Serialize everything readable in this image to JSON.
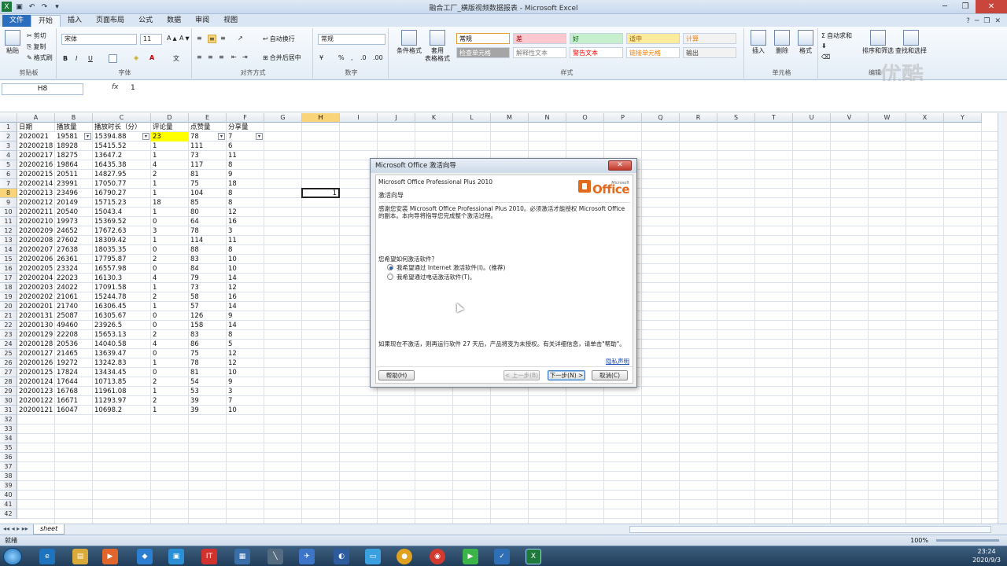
{
  "window": {
    "title": "融合工厂_横版视频数据报表 - Microsoft Excel"
  },
  "tabs": [
    "文件",
    "开始",
    "插入",
    "页面布局",
    "公式",
    "数据",
    "审阅",
    "视图"
  ],
  "ribbon": {
    "clipboard": {
      "label": "剪贴板",
      "paste": "粘贴",
      "cut": "剪切",
      "copy": "复制",
      "format_painter": "格式刷"
    },
    "font": {
      "label": "字体",
      "name": "宋体",
      "size": "11"
    },
    "alignment": {
      "label": "对齐方式",
      "wrap": "自动换行",
      "merge": "合并后居中"
    },
    "number": {
      "label": "数字",
      "format": "常规"
    },
    "styles": {
      "label": "样式",
      "cond": "条件格式",
      "table": "套用\n表格格式",
      "cells": [
        {
          "t": "常规",
          "bg": "#ffffff",
          "c": "#000000"
        },
        {
          "t": "差",
          "bg": "#ffc7ce",
          "c": "#9c0006"
        },
        {
          "t": "好",
          "bg": "#c6efce",
          "c": "#006100"
        },
        {
          "t": "适中",
          "bg": "#ffeb9c",
          "c": "#9c5700"
        },
        {
          "t": "计算",
          "bg": "#f2f2f2",
          "c": "#fa7d00"
        },
        {
          "t": "检查单元格",
          "bg": "#a5a5a5",
          "c": "#ffffff"
        },
        {
          "t": "解释性文本",
          "bg": "#ffffff",
          "c": "#7f7f7f"
        },
        {
          "t": "警告文本",
          "bg": "#ffffff",
          "c": "#ff0000"
        },
        {
          "t": "链接单元格",
          "bg": "#ffffff",
          "c": "#fa7d00"
        },
        {
          "t": "输出",
          "bg": "#f2f2f2",
          "c": "#3f3f3f"
        }
      ]
    },
    "cells": {
      "label": "单元格",
      "insert": "插入",
      "delete": "删除",
      "format": "格式"
    },
    "editing": {
      "label": "编辑",
      "autosum": "自动求和",
      "sort": "排序和筛选",
      "find": "查找和选择"
    }
  },
  "formula_bar": {
    "name": "H8",
    "fx": "fx",
    "value": "1"
  },
  "columns": [
    "A",
    "B",
    "C",
    "D",
    "E",
    "F",
    "G",
    "H",
    "I",
    "J",
    "K",
    "L",
    "M",
    "N",
    "O",
    "P",
    "Q",
    "R",
    "S",
    "T",
    "U",
    "V",
    "W",
    "X",
    "Y"
  ],
  "headers": [
    "日期",
    "播放量",
    "播放时长（分）",
    "评论量",
    "点赞量",
    "分享量"
  ],
  "rows": [
    [
      "2020021",
      "19581",
      "15394.88",
      "23",
      "78",
      "7"
    ],
    [
      "20200218",
      "18928",
      "15415.52",
      "1",
      "111",
      "6"
    ],
    [
      "20200217",
      "18275",
      "13647.2",
      "1",
      "73",
      "11"
    ],
    [
      "20200216",
      "19864",
      "16435.38",
      "4",
      "117",
      "8"
    ],
    [
      "20200215",
      "20511",
      "14827.95",
      "2",
      "81",
      "9"
    ],
    [
      "20200214",
      "23991",
      "17050.77",
      "1",
      "75",
      "18"
    ],
    [
      "20200213",
      "23496",
      "16790.27",
      "1",
      "104",
      "8"
    ],
    [
      "20200212",
      "20149",
      "15715.23",
      "18",
      "85",
      "8"
    ],
    [
      "20200211",
      "20540",
      "15043.4",
      "1",
      "80",
      "12"
    ],
    [
      "20200210",
      "19973",
      "15369.52",
      "0",
      "64",
      "16"
    ],
    [
      "20200209",
      "24652",
      "17672.63",
      "3",
      "78",
      "3"
    ],
    [
      "20200208",
      "27602",
      "18309.42",
      "1",
      "114",
      "11"
    ],
    [
      "20200207",
      "27638",
      "18035.35",
      "0",
      "88",
      "8"
    ],
    [
      "20200206",
      "26361",
      "17795.87",
      "2",
      "83",
      "10"
    ],
    [
      "20200205",
      "23324",
      "16557.98",
      "0",
      "84",
      "10"
    ],
    [
      "20200204",
      "22023",
      "16130.3",
      "4",
      "79",
      "14"
    ],
    [
      "20200203",
      "24022",
      "17091.58",
      "1",
      "73",
      "12"
    ],
    [
      "20200202",
      "21061",
      "15244.78",
      "2",
      "58",
      "16"
    ],
    [
      "20200201",
      "21740",
      "16306.45",
      "1",
      "57",
      "14"
    ],
    [
      "20200131",
      "25087",
      "16305.67",
      "0",
      "126",
      "9"
    ],
    [
      "20200130",
      "49460",
      "23926.5",
      "0",
      "158",
      "14"
    ],
    [
      "20200129",
      "22208",
      "15653.13",
      "2",
      "83",
      "8"
    ],
    [
      "20200128",
      "20536",
      "14040.58",
      "4",
      "86",
      "5"
    ],
    [
      "20200127",
      "21465",
      "13639.47",
      "0",
      "75",
      "12"
    ],
    [
      "20200126",
      "19272",
      "13242.83",
      "1",
      "78",
      "12"
    ],
    [
      "20200125",
      "17824",
      "13434.45",
      "0",
      "81",
      "10"
    ],
    [
      "20200124",
      "17644",
      "10713.85",
      "2",
      "54",
      "9"
    ],
    [
      "20200123",
      "16768",
      "11961.08",
      "1",
      "53",
      "3"
    ],
    [
      "20200122",
      "16671",
      "11293.97",
      "2",
      "39",
      "7"
    ],
    [
      "20200121",
      "16047",
      "10698.2",
      "1",
      "39",
      "10"
    ]
  ],
  "selected_cell": {
    "ref": "H8",
    "value": "1"
  },
  "sheet_tab": "sheet",
  "status": {
    "ready": "就绪",
    "zoom": "100%"
  },
  "dialog": {
    "title": "Microsoft Office 激活向导",
    "product": "Microsoft Office Professional Plus 2010",
    "logo_text": "Office",
    "logo_super": "Microsoft",
    "heading": "激活向导",
    "intro": "感谢您安装 Microsoft Office Professional Plus 2010。必须激活才能授权 Microsoft Office 的副本。本向导将指导您完成整个激活过程。",
    "question": "您希望如何激活软件？",
    "option1": "我希望通过 Internet 激活软件(I)。(推荐)",
    "option2": "我希望通过电话激活软件(T)。",
    "warning": "如果现在不激活，则再运行软件 27 天后，产品将变为未授权。有关详细信息，请单击\"帮助\"。",
    "privacy": "隐私声明",
    "help": "帮助(H)",
    "back": "< 上一步(B)",
    "next": "下一步(N) >",
    "cancel": "取消(C)"
  },
  "watermark": "优酷",
  "clock": {
    "time": "23:24",
    "date": "2020/9/3"
  }
}
